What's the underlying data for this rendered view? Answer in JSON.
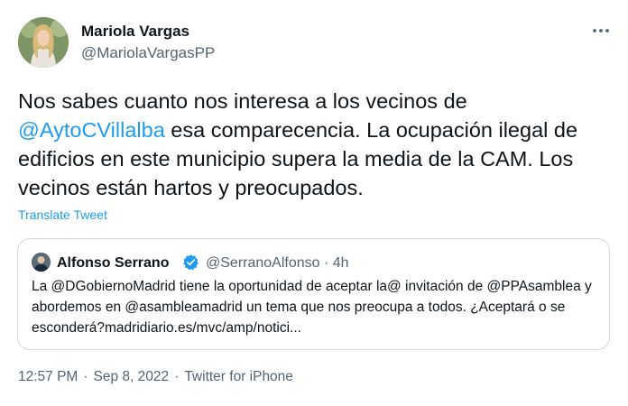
{
  "tweet": {
    "author_name": "Mariola Vargas",
    "author_handle": "@MariolaVargasPP",
    "text_part1": "Nos sabes cuanto nos interesa a los vecinos de ",
    "mention": "@AytoCVillalba",
    "text_part2": " esa comparecencia. La ocupación ilegal de edificios en este municipio supera la media de la CAM. Los vecinos están hartos y preocupados.",
    "translate_label": "Translate Tweet",
    "more_icon": "ellipsis-icon"
  },
  "quoted_tweet": {
    "author_name": "Alfonso Serrano",
    "verified_icon": "verified-badge-icon",
    "author_handle": "@SerranoAlfonso",
    "time_separator": "·",
    "time": "4h",
    "text": "La @DGobiernoMadrid tiene la oportunidad de aceptar la@ invitación de @PPAsamblea y abordemos en @asambleamadrid un tema que nos preocupa a todos. ¿Aceptará o se esconderá?madridiario.es/mvc/amp/notici..."
  },
  "meta": {
    "time": "12:57 PM",
    "separator": "·",
    "date": "Sep 8, 2022",
    "source": "Twitter for iPhone"
  },
  "colors": {
    "accent": "#1d9bf0",
    "secondary_text": "#536471",
    "border": "#cfd9de"
  }
}
